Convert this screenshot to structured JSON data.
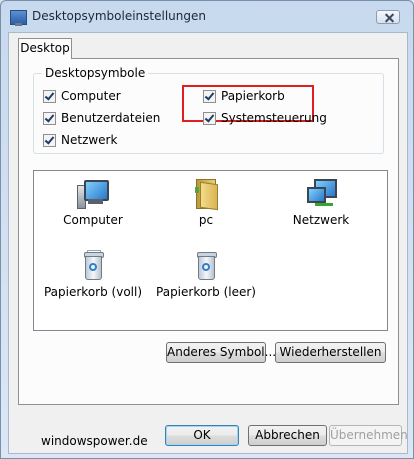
{
  "window": {
    "title": "Desktopsymboleinstellungen"
  },
  "tabs": [
    {
      "label": "Desktop"
    }
  ],
  "group": {
    "legend": "Desktopsymbole",
    "checkboxes": [
      {
        "label": "Computer",
        "checked": true
      },
      {
        "label": "Papierkorb",
        "checked": true,
        "highlighted": true
      },
      {
        "label": "Benutzerdateien",
        "checked": true
      },
      {
        "label": "Systemsteuerung",
        "checked": true
      },
      {
        "label": "Netzwerk",
        "checked": true
      }
    ]
  },
  "icons": [
    {
      "label": "Computer",
      "icon": "computer-icon"
    },
    {
      "label": "pc",
      "icon": "user-folder-icon"
    },
    {
      "label": "Netzwerk",
      "icon": "network-icon"
    },
    {
      "label": "Papierkorb (voll)",
      "icon": "recycle-bin-full-icon"
    },
    {
      "label": "Papierkorb (leer)",
      "icon": "recycle-bin-empty-icon"
    }
  ],
  "buttons": {
    "change_icon": "Anderes Symbol...",
    "restore": "Wiederherstellen",
    "ok": "OK",
    "cancel": "Abbrechen",
    "apply": "Übernehmen"
  },
  "footer": {
    "site": "windowspower.de"
  },
  "colors": {
    "highlight": "#e02020",
    "accent": "#3c7fb1"
  }
}
